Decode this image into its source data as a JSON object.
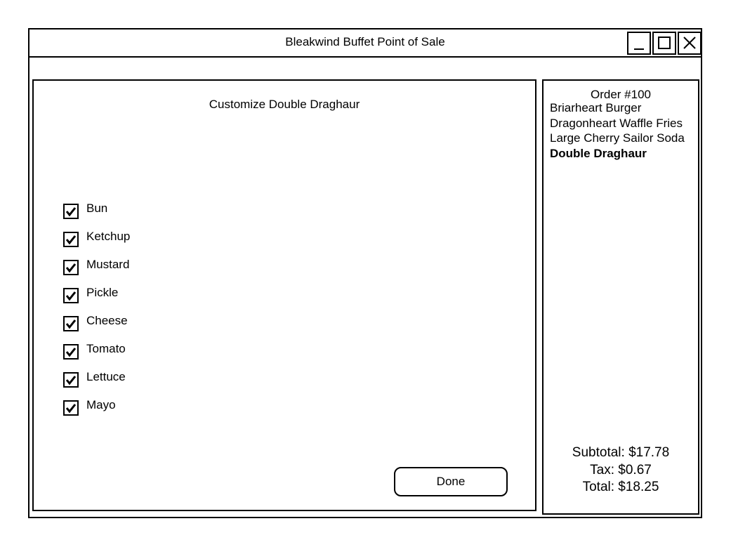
{
  "window": {
    "title": "Bleakwind Buffet Point of Sale",
    "controls": {
      "minimize_icon": "minimize-icon",
      "maximize_icon": "maximize-icon",
      "close_icon": "close-icon"
    }
  },
  "customize": {
    "title": "Customize Double Draghaur",
    "options": [
      {
        "label": "Bun",
        "checked": true
      },
      {
        "label": "Ketchup",
        "checked": true
      },
      {
        "label": "Mustard",
        "checked": true
      },
      {
        "label": "Pickle",
        "checked": true
      },
      {
        "label": "Cheese",
        "checked": true
      },
      {
        "label": "Tomato",
        "checked": true
      },
      {
        "label": "Lettuce",
        "checked": true
      },
      {
        "label": "Mayo",
        "checked": true
      }
    ],
    "done_label": "Done"
  },
  "order": {
    "title": "Order #100",
    "items": [
      {
        "name": "Briarheart Burger",
        "selected": false
      },
      {
        "name": "Dragonheart Waffle Fries",
        "selected": false
      },
      {
        "name": "Large Cherry Sailor Soda",
        "selected": false
      },
      {
        "name": "Double Draghaur",
        "selected": true
      }
    ],
    "subtotal": "Subtotal: $17.78",
    "tax": "Tax: $0.67",
    "total": "Total: $18.25"
  }
}
